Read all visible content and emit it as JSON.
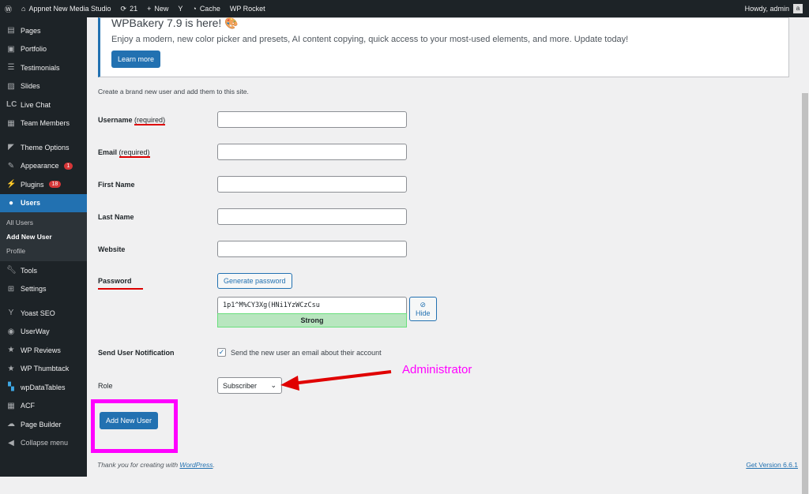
{
  "adminbar": {
    "site": "Appnet New Media Studio",
    "updates": "21",
    "new": "New",
    "cache": "Cache",
    "rocket": "WP Rocket",
    "howdy": "Howdy, admin"
  },
  "sidebar": {
    "items": [
      {
        "label": "Pages",
        "icon": "pages-icon"
      },
      {
        "label": "Portfolio",
        "icon": "portfolio-icon"
      },
      {
        "label": "Testimonials",
        "icon": "testimonials-icon"
      },
      {
        "label": "Slides",
        "icon": "slides-icon"
      },
      {
        "label": "Live Chat",
        "icon": "livechat-icon"
      },
      {
        "label": "Team Members",
        "icon": "team-icon"
      },
      {
        "label": "Theme Options",
        "icon": "theme-icon"
      },
      {
        "label": "Appearance",
        "badge": "1"
      },
      {
        "label": "Plugins",
        "badge": "18"
      },
      {
        "label": "Users"
      },
      {
        "label": "Tools"
      },
      {
        "label": "Settings"
      },
      {
        "label": "Yoast SEO"
      },
      {
        "label": "UserWay"
      },
      {
        "label": "WP Reviews"
      },
      {
        "label": "WP Thumbtack"
      },
      {
        "label": "wpDataTables"
      },
      {
        "label": "ACF"
      },
      {
        "label": "Page Builder"
      },
      {
        "label": "Collapse menu"
      }
    ],
    "users_sub": [
      "All Users",
      "Add New User",
      "Profile"
    ]
  },
  "notice": {
    "title": "WPBakery 7.9 is here! 🎨",
    "text": "Enjoy a modern, new color picker and presets, AI content copying, quick access to your most-used elements, and more. Update today!",
    "button": "Learn more"
  },
  "form": {
    "intro": "Create a brand new user and add them to this site.",
    "username": "Username",
    "email": "Email",
    "required": "(required)",
    "first_name": "First Name",
    "last_name": "Last Name",
    "website": "Website",
    "password": "Password",
    "generate": "Generate password",
    "password_value": "1p1^M%CY3Xg(HNi1YzWCzCsu",
    "strength": "Strong",
    "hide": "Hide",
    "notification": "Send User Notification",
    "notification_text": "Send the new user an email about their account",
    "notification_checked": true,
    "role": "Role",
    "role_value": "Subscriber",
    "submit": "Add New User"
  },
  "annotation": {
    "text": "Administrator",
    "color": "#ff00ff",
    "arrow_color": "#e00000"
  },
  "footer": {
    "thanks": "Thank you for creating with ",
    "wp": "WordPress",
    "period": ".",
    "version": "Get Version 6.6.1"
  }
}
